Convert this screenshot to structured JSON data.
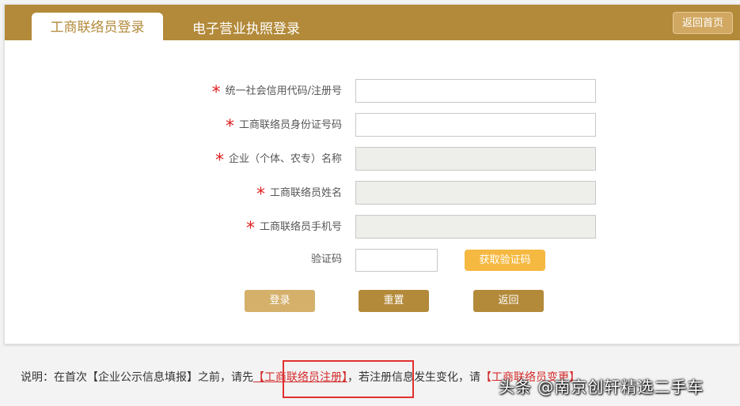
{
  "tabs": {
    "active_label": "工商联络员登录",
    "inactive_label": "电子营业执照登录"
  },
  "header": {
    "home_label": "返回首页"
  },
  "form": {
    "required_mark": "*",
    "fields": [
      {
        "label": "统一社会信用代码/注册号",
        "value": "",
        "required": true,
        "disabled": false
      },
      {
        "label": "工商联络员身份证号码",
        "value": "",
        "required": true,
        "disabled": false
      },
      {
        "label": "企业（个体、农专）名称",
        "value": "",
        "required": true,
        "disabled": true
      },
      {
        "label": "工商联络员姓名",
        "value": "",
        "required": true,
        "disabled": true
      },
      {
        "label": "工商联络员手机号",
        "value": "",
        "required": true,
        "disabled": true
      }
    ],
    "captcha_label": "验证码",
    "captcha_value": "",
    "captcha_button": "获取验证码"
  },
  "actions": {
    "login": "登录",
    "reset": "重置",
    "back": "返回"
  },
  "note": {
    "prefix": "说明：在首次【企业公示信息填报】之前，请先",
    "link_register": "【工商联络员注册】",
    "middle": "，若注册信息发生变化，请",
    "link_change": "【工商联络员变更】"
  },
  "watermark": "头条 @南京创轩精选二手车",
  "colors": {
    "brand": "#b38a3a",
    "captcha": "#f5b942",
    "required": "#e02020",
    "link": "#d42a2a"
  }
}
